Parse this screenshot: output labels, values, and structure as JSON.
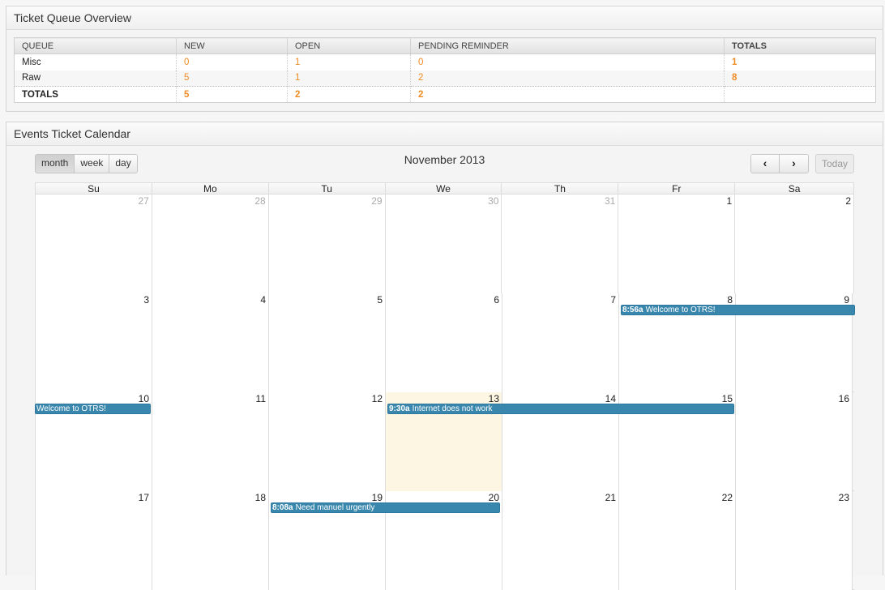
{
  "queue_widget": {
    "title": "Ticket Queue Overview",
    "headers": [
      "QUEUE",
      "NEW",
      "OPEN",
      "PENDING REMINDER",
      "TOTALS"
    ],
    "rows": [
      {
        "queue": "Misc",
        "new": "0",
        "open": "1",
        "pending": "0",
        "totals": "1"
      },
      {
        "queue": "Raw",
        "new": "5",
        "open": "1",
        "pending": "2",
        "totals": "8"
      }
    ],
    "totals_row": {
      "label": "TOTALS",
      "new": "5",
      "open": "2",
      "pending": "2",
      "totals": ""
    }
  },
  "calendar_widget": {
    "title": "Events Ticket Calendar",
    "views": [
      "month",
      "week",
      "day"
    ],
    "active_view": "month",
    "month_title": "November 2013",
    "prev_icon": "‹",
    "next_icon": "›",
    "today_label": "Today",
    "weekdays": [
      "Su",
      "Mo",
      "Tu",
      "We",
      "Th",
      "Fr",
      "Sa"
    ],
    "weeks": [
      [
        "27",
        "28",
        "29",
        "30",
        "31",
        "1",
        "2"
      ],
      [
        "3",
        "4",
        "5",
        "6",
        "7",
        "8",
        "9"
      ],
      [
        "10",
        "11",
        "12",
        "13",
        "14",
        "15",
        "16"
      ],
      [
        "17",
        "18",
        "19",
        "20",
        "21",
        "22",
        "23"
      ]
    ],
    "events": [
      {
        "time": "8:56a",
        "title": "Welcome to OTRS!"
      },
      {
        "time": "",
        "title": "Welcome to OTRS!"
      },
      {
        "time": "9:30a",
        "title": "Internet does not work"
      },
      {
        "time": "8:08a",
        "title": "Need manuel urgently"
      }
    ],
    "colors": {
      "event": "#3a87ad",
      "today": "#fdf6e3",
      "count": "#f08b22"
    }
  }
}
